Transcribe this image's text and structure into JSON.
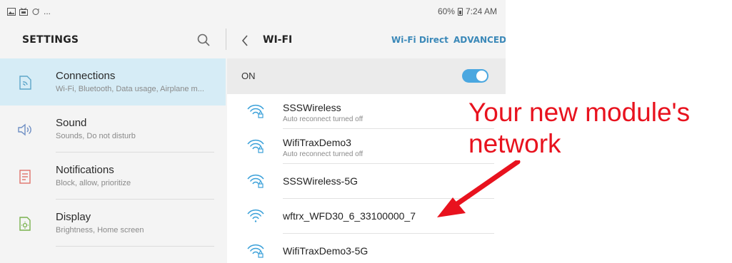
{
  "status_bar": {
    "left_icons": [
      "image-icon",
      "media-icon",
      "sync-icon"
    ],
    "ellipsis": "...",
    "battery": "60%",
    "time": "7:24 AM"
  },
  "settings": {
    "title": "SETTINGS",
    "items": [
      {
        "icon": "connections-icon",
        "title": "Connections",
        "subtitle": "Wi-Fi, Bluetooth, Data usage, Airplane m...",
        "selected": true
      },
      {
        "icon": "sound-icon",
        "title": "Sound",
        "subtitle": "Sounds, Do not disturb",
        "selected": false
      },
      {
        "icon": "notifications-icon",
        "title": "Notifications",
        "subtitle": "Block, allow, prioritize",
        "selected": false
      },
      {
        "icon": "display-icon",
        "title": "Display",
        "subtitle": "Brightness, Home screen",
        "selected": false
      }
    ]
  },
  "wifi": {
    "title": "WI-FI",
    "wifi_direct": "Wi-Fi Direct",
    "advanced": "ADVANCED",
    "on_label": "ON",
    "enabled": true,
    "networks": [
      {
        "name": "SSSWireless",
        "status": "Auto reconnect turned off",
        "locked": true
      },
      {
        "name": "WifiTraxDemo3",
        "status": "Auto reconnect turned off",
        "locked": true
      },
      {
        "name": "SSSWireless-5G",
        "status": "",
        "locked": true
      },
      {
        "name": "wftrx_WFD30_6_33100000_7",
        "status": "",
        "locked": false
      },
      {
        "name": "WifiTraxDemo3-5G",
        "status": "",
        "locked": true
      }
    ]
  },
  "annotation": {
    "line1": "Your new module's",
    "line2": "network",
    "color": "#e8121e"
  },
  "colors": {
    "accent": "#3a88b8",
    "selected_bg": "#d6ecf6",
    "toggle_on": "#4aa7e0"
  }
}
